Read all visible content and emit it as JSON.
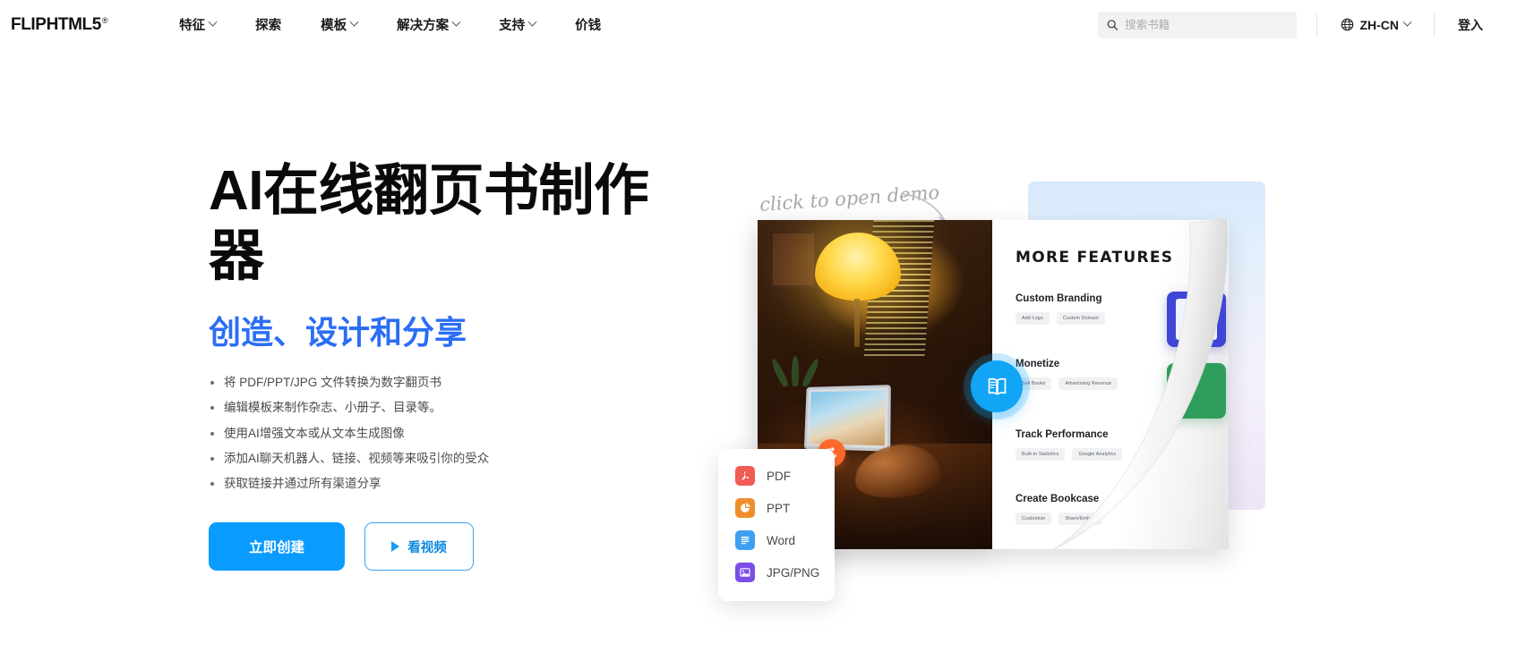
{
  "header": {
    "logo": "FLIPHTML5",
    "logo_sup": "®",
    "nav": [
      {
        "label": "特征",
        "has_caret": true
      },
      {
        "label": "探索",
        "has_caret": false
      },
      {
        "label": "模板",
        "has_caret": true
      },
      {
        "label": "解决方案",
        "has_caret": true
      },
      {
        "label": "支持",
        "has_caret": true
      },
      {
        "label": "价钱",
        "has_caret": false
      }
    ],
    "search": {
      "placeholder": "搜索书籍",
      "value": ""
    },
    "language": "ZH-CN",
    "login": "登入"
  },
  "hero": {
    "title": "AI在线翻页书制作器",
    "subtitle": "创造、设计和分享",
    "subtitle_color": "#2b6ef5",
    "bullets": [
      "将 PDF/PPT/JPG 文件转换为数字翻页书",
      "编辑模板来制作杂志、小册子、目录等。",
      "使用AI增强文本或从文本生成图像",
      "添加AI聊天机器人、链接、视频等来吸引你的受众",
      "获取链接并通过所有渠道分享"
    ],
    "primary_cta": "立即创建",
    "secondary_cta": "看视频",
    "primary_color": "#0a9bff"
  },
  "art": {
    "demo_note": "click to open demo",
    "feature_page": {
      "title": "MORE FEATURES",
      "sections": [
        {
          "heading": "Custom Branding",
          "tags": [
            "Add Logo",
            "Custom Domain"
          ]
        },
        {
          "heading": "Monetize",
          "tags": [
            "Sell Books",
            "Advertising Revenue"
          ]
        },
        {
          "heading": "Track Performance",
          "tags": [
            "Built-in Statistics",
            "Google Analytics"
          ]
        },
        {
          "heading": "Create Bookcase",
          "tags": [
            "Customize",
            "Share/Embed"
          ]
        }
      ]
    },
    "format_menu": [
      {
        "label": "PDF",
        "color": "#f05b55",
        "icon": "pdf-icon"
      },
      {
        "label": "PPT",
        "color": "#ef8f2c",
        "icon": "ppt-icon"
      },
      {
        "label": "Word",
        "color": "#3d9ff0",
        "icon": "word-icon"
      },
      {
        "label": "JPG/PNG",
        "color": "#7b4ee8",
        "icon": "image-icon"
      }
    ]
  }
}
